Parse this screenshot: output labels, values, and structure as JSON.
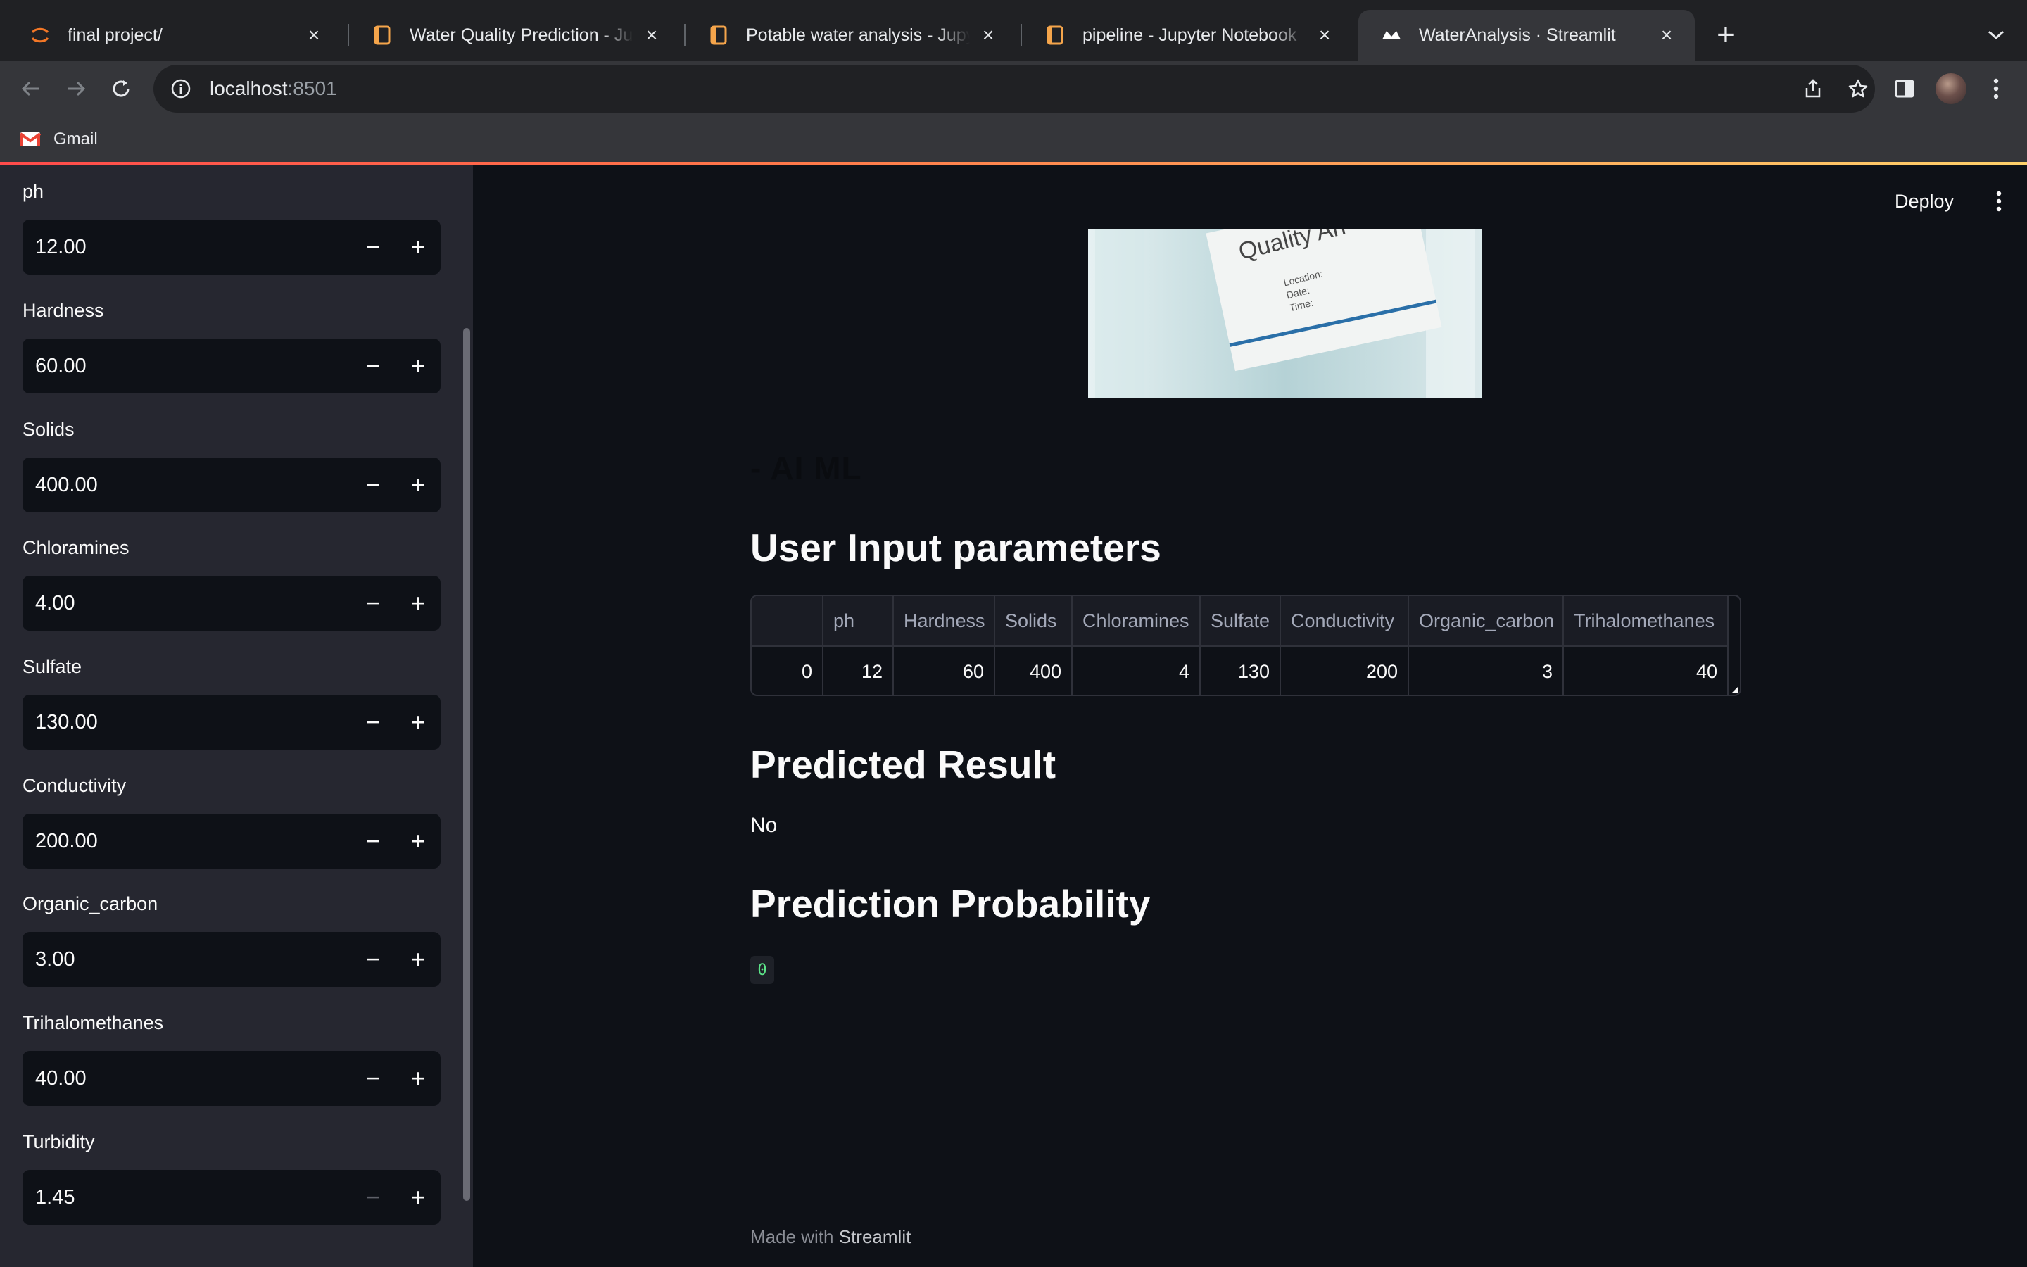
{
  "browser": {
    "tabs": [
      {
        "title": "final project/",
        "icon": "jupyter-icon",
        "active": false
      },
      {
        "title": "Water Quality Prediction - Jupyter Notebook",
        "icon": "notebook-icon",
        "active": false
      },
      {
        "title": "Potable water analysis - Jupyter Notebook",
        "icon": "notebook-icon",
        "active": false
      },
      {
        "title": "pipeline - Jupyter Notebook",
        "icon": "notebook-icon",
        "active": false
      },
      {
        "title": "WaterAnalysis · Streamlit",
        "icon": "streamlit-icon",
        "active": true
      }
    ],
    "url_host": "localhost",
    "url_port": ":8501",
    "bookmarks": [
      {
        "label": "Gmail",
        "icon": "gmail-icon"
      }
    ]
  },
  "sidebar": {
    "fields": [
      {
        "label": "ph",
        "value": "12.00"
      },
      {
        "label": "Hardness",
        "value": "60.00"
      },
      {
        "label": "Solids",
        "value": "400.00"
      },
      {
        "label": "Chloramines",
        "value": "4.00"
      },
      {
        "label": "Sulfate",
        "value": "130.00"
      },
      {
        "label": "Conductivity",
        "value": "200.00"
      },
      {
        "label": "Organic_carbon",
        "value": "3.00"
      },
      {
        "label": "Trihalomethanes",
        "value": "40.00"
      },
      {
        "label": "Turbidity",
        "value": "1.45"
      }
    ],
    "minus_symbol": "−",
    "plus_symbol": "+"
  },
  "header": {
    "deploy_label": "Deploy"
  },
  "main": {
    "hero_sign_title": "Quality An",
    "hero_sign_lines": [
      "Location:",
      "Date:",
      "Time:"
    ],
    "subtitle": "- AI ML",
    "input_heading": "User Input parameters",
    "table": {
      "columns": [
        "",
        "ph",
        "Hardness",
        "Solids",
        "Chloramines",
        "Sulfate",
        "Conductivity",
        "Organic_carbon",
        "Trihalomethanes"
      ],
      "rows": [
        [
          "0",
          "12",
          "60",
          "400",
          "4",
          "130",
          "200",
          "3",
          "40"
        ]
      ]
    },
    "result_heading": "Predicted Result",
    "result_value": "No",
    "probability_heading": "Prediction Probability",
    "probability_value": "0",
    "footer_prefix": "Made with",
    "footer_brand": "Streamlit"
  }
}
